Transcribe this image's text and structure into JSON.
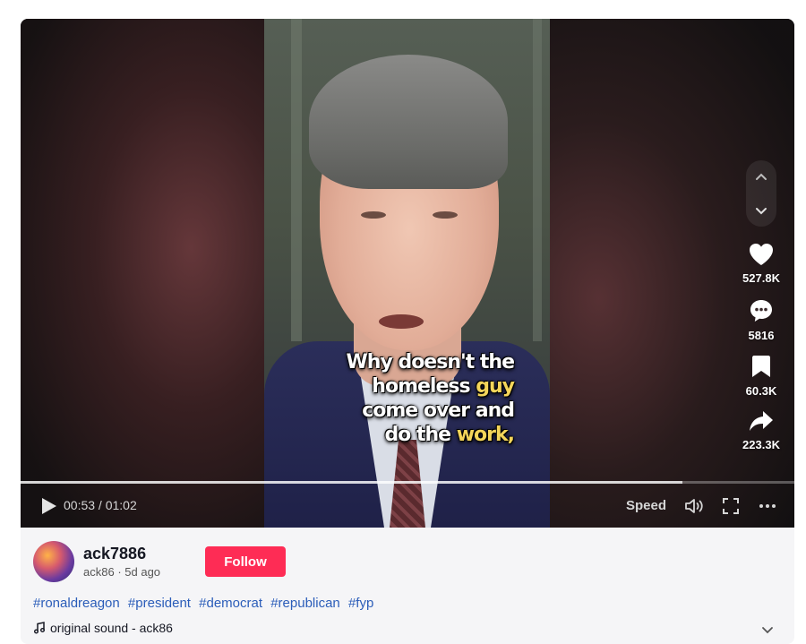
{
  "video": {
    "caption_line1": "Why doesn't the",
    "caption_line2_a": "homeless ",
    "caption_line2_b": "guy",
    "caption_line3": "come over and",
    "caption_line4_a": "do the ",
    "caption_line4_b": "work,",
    "caption_highlight_color": "#f4d55a",
    "progress_fraction": 0.855
  },
  "navigation": {
    "up_icon": "chevron-up-icon",
    "down_icon": "chevron-down-icon"
  },
  "actions": {
    "likes": "527.8K",
    "comments": "5816",
    "saves": "60.3K",
    "shares": "223.3K"
  },
  "controls": {
    "time": "00:53 / 01:02",
    "speed_label": "Speed",
    "icons": [
      "play-icon",
      "volume-icon",
      "fullscreen-icon",
      "more-icon"
    ]
  },
  "author": {
    "username": "ack7886",
    "handle": "ack86",
    "posted": "5d ago",
    "follow_label": "Follow"
  },
  "hashtags": [
    "#ronaldreagon",
    "#president",
    "#democrat",
    "#republican",
    "#fyp"
  ],
  "sound": {
    "label": "original sound - ack86"
  },
  "colors": {
    "follow": "#fe2c55",
    "hashtag": "#2b5db9"
  }
}
